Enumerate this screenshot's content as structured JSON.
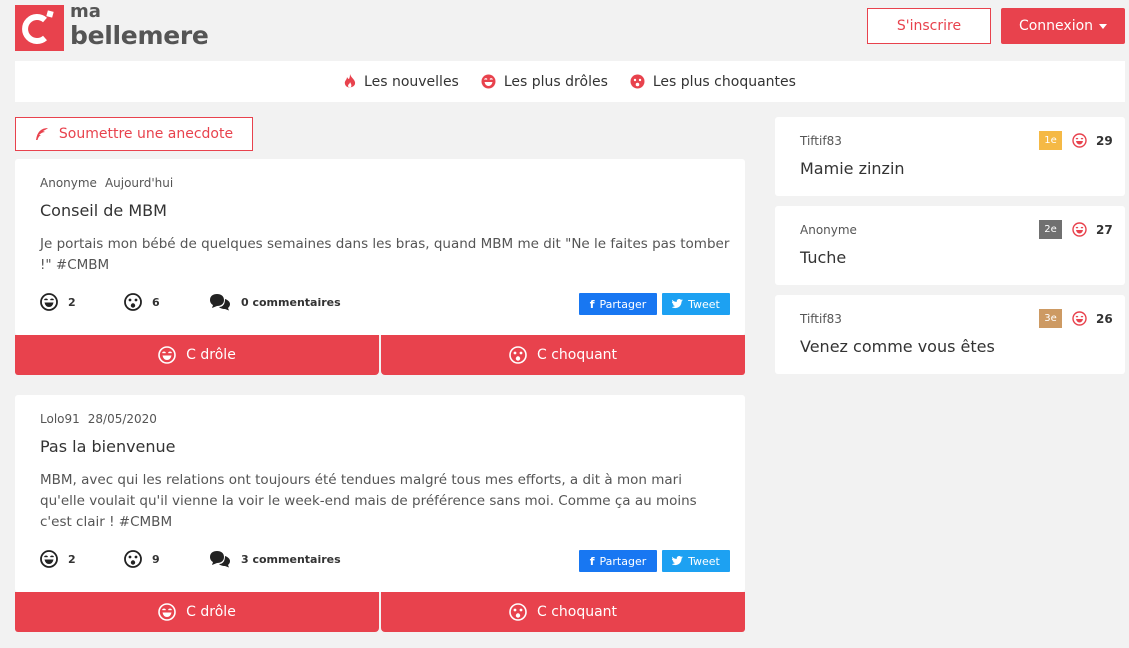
{
  "brand": {
    "ma": "ma",
    "name": "bellemere",
    "logo_letter": "C"
  },
  "header": {
    "signup": "S'inscrire",
    "login": "Connexion"
  },
  "nav": [
    {
      "label": "Les nouvelles",
      "icon": "flame-icon"
    },
    {
      "label": "Les plus drôles",
      "icon": "laugh-icon"
    },
    {
      "label": "Les plus choquantes",
      "icon": "shocked-icon"
    }
  ],
  "submit_label": "Soumettre une anecdote",
  "posts": [
    {
      "author": "Anonyme",
      "date": "Aujourd'hui",
      "title": "Conseil de MBM",
      "body": "Je portais mon bébé de quelques semaines dans les bras, quand MBM me dit \"Ne le faites pas tomber !\" #CMBM",
      "funny": "2",
      "shocking": "6",
      "comments": "0 commentaires",
      "share_fb": "Partager",
      "share_tw": "Tweet",
      "vote_funny": "C drôle",
      "vote_shocking": "C choquant"
    },
    {
      "author": "Lolo91",
      "date": "28/05/2020",
      "title": "Pas la bienvenue",
      "body": "MBM, avec qui les relations ont toujours été tendues malgré tous mes efforts, a dit à mon mari qu'elle voulait qu'il vienne la voir le week-end mais de préférence sans moi. Comme ça au moins c'est clair ! #CMBM",
      "funny": "2",
      "shocking": "9",
      "comments": "3 commentaires",
      "share_fb": "Partager",
      "share_tw": "Tweet",
      "vote_funny": "C drôle",
      "vote_shocking": "C choquant"
    }
  ],
  "top": [
    {
      "author": "Tiftif83",
      "title": "Mamie zinzin",
      "rank": "1e",
      "rank_color": "#f5b945",
      "count": "29"
    },
    {
      "author": "Anonyme",
      "title": "Tuche",
      "rank": "2e",
      "rank_color": "#707070",
      "count": "27"
    },
    {
      "author": "Tiftif83",
      "title": "Venez comme vous êtes",
      "rank": "3e",
      "rank_color": "#cd9a63",
      "count": "26"
    }
  ],
  "colors": {
    "accent": "#e8424d",
    "facebook": "#1877f2",
    "twitter": "#1da1f2"
  }
}
